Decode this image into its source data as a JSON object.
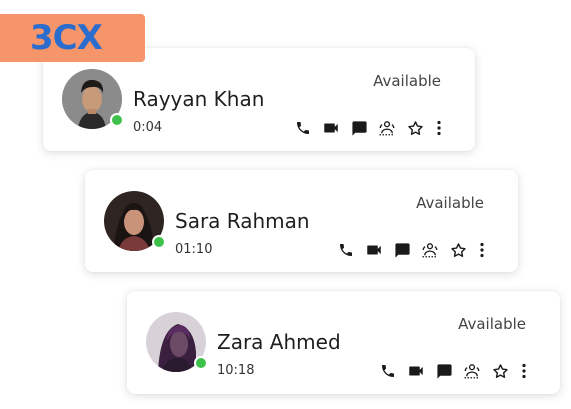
{
  "brand": {
    "logo_text": "3CX",
    "badge_color": "#f7956a",
    "logo_color": "#2a6dce"
  },
  "presence_color": "#3ec14b",
  "contacts": [
    {
      "name": "Rayyan Khan",
      "duration": "0:04",
      "status": "Available"
    },
    {
      "name": "Sara Rahman",
      "duration": "01:10",
      "status": "Available"
    },
    {
      "name": "Zara Ahmed",
      "duration": "10:18",
      "status": "Available"
    }
  ],
  "action_icons": [
    "phone-icon",
    "video-icon",
    "chat-icon",
    "transfer-icon",
    "star-icon",
    "more-icon"
  ]
}
